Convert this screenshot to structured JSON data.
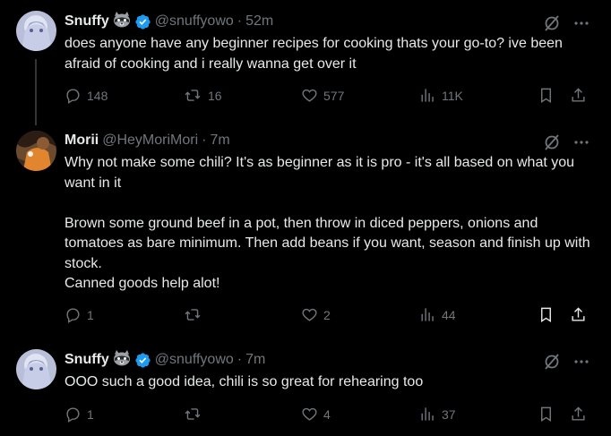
{
  "tweets": [
    {
      "name": "Snuffy",
      "handle": "@snuffyowo",
      "dot": "·",
      "time": "52m",
      "verified": true,
      "text": [
        "does anyone have any beginner recipes for cooking thats your go-to? ive been afraid of cooking and i really wanna get over it"
      ],
      "replies": "148",
      "reposts": "16",
      "likes": "577",
      "views": "11K"
    },
    {
      "name": "Morii",
      "handle": "@HeyMoriMori",
      "dot": "·",
      "time": "7m",
      "verified": false,
      "text": [
        "Why not make some chili? It's as beginner as it is pro - it's all based on what you want in it",
        "",
        "Brown some ground beef in a pot, then throw in diced peppers, onions and tomatoes as bare minimum. Then add beans if you want, season and finish up with stock.",
        "Canned goods help alot!"
      ],
      "replies": "1",
      "reposts": "",
      "likes": "2",
      "views": "44"
    },
    {
      "name": "Snuffy",
      "handle": "@snuffyowo",
      "dot": "·",
      "time": "7m",
      "verified": true,
      "text": [
        "OOO such a good idea, chili is so great for rehearing too"
      ],
      "replies": "1",
      "reposts": "",
      "likes": "4",
      "views": "37"
    }
  ],
  "icons": {
    "raccoon": "raccoon-emoji-icon",
    "verified": "verified-badge-icon",
    "grok": "grok-icon",
    "more": "more-icon",
    "reply": "reply-icon",
    "repost": "repost-icon",
    "like": "like-icon",
    "views": "views-icon",
    "bookmark": "bookmark-icon",
    "share": "share-icon"
  },
  "colors": {
    "background": "#000000",
    "text": "#e7e9ea",
    "muted": "#71767b",
    "verified": "#1d9bf0",
    "thread_line": "#333639"
  }
}
